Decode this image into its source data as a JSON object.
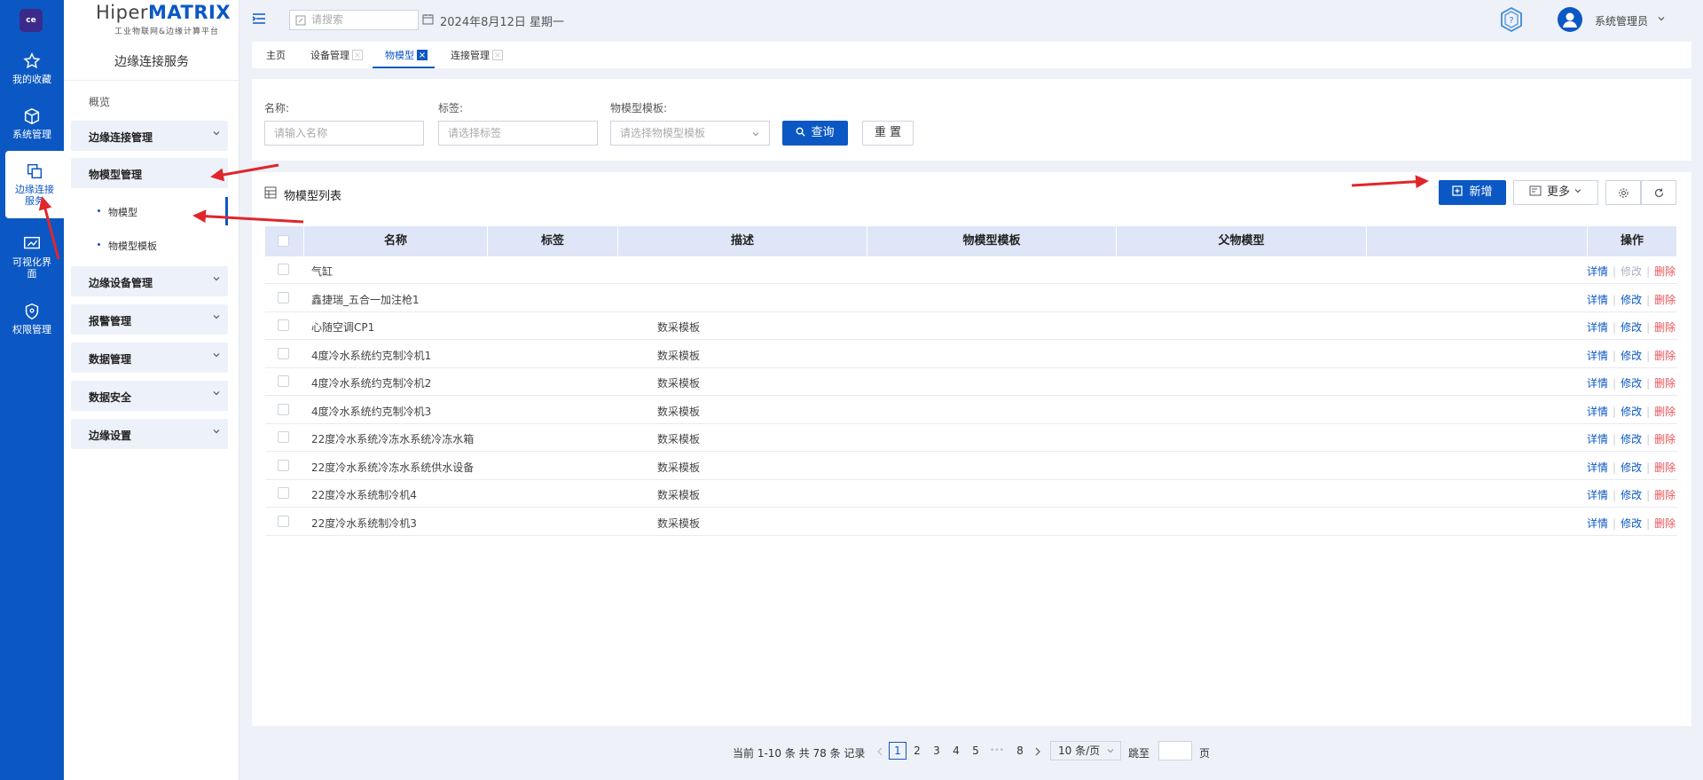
{
  "nav": {
    "logo_text": "ce",
    "items": [
      {
        "label": "我的收藏",
        "icon": "star-icon"
      },
      {
        "label": "系统管理",
        "icon": "cube-icon"
      },
      {
        "label": "边缘连接服务",
        "icon": "copy-icon"
      },
      {
        "label": "可视化界面",
        "icon": "monitor-icon"
      },
      {
        "label": "权限管理",
        "icon": "shield-icon"
      }
    ]
  },
  "brand": {
    "name_part1": "Hiper",
    "name_part2": "MATRIX",
    "subtitle": "工业物联网&边缘计算平台"
  },
  "sidebar": {
    "title": "边缘连接服务",
    "overview": "概览",
    "groups": [
      "边缘连接管理",
      "物模型管理",
      "边缘设备管理",
      "报警管理",
      "数据管理",
      "数据安全",
      "边缘设置"
    ],
    "subitems": [
      "物模型",
      "物模型模板"
    ]
  },
  "topbar": {
    "search_placeholder": "请搜索",
    "date": "2024年8月12日 星期一",
    "username": "系统管理员"
  },
  "tabs": [
    {
      "label": "主页"
    },
    {
      "label": "设备管理"
    },
    {
      "label": "物模型"
    },
    {
      "label": "连接管理"
    }
  ],
  "filter": {
    "name_label": "名称:",
    "name_placeholder": "请输入名称",
    "tag_label": "标签:",
    "tag_placeholder": "请选择标签",
    "template_label": "物模型模板:",
    "template_placeholder": "请选择物模型模板",
    "query_label": "查询",
    "reset_label": "重 置"
  },
  "list": {
    "title": "物模型列表",
    "add_label": "新增",
    "more_label": "更多",
    "columns": [
      "名称",
      "标签",
      "描述",
      "物模型模板",
      "父物模型",
      "操作"
    ],
    "op_detail": "详情",
    "op_edit": "修改",
    "op_delete": "删除",
    "rows": [
      {
        "name": "气缸",
        "desc": "",
        "edit_disabled": true
      },
      {
        "name": "鑫捷瑞_五合一加注枪1",
        "desc": "",
        "edit_disabled": false
      },
      {
        "name": "心随空调CP1",
        "desc": "数采模板",
        "edit_disabled": false
      },
      {
        "name": "4度冷水系统约克制冷机1",
        "desc": "数采模板",
        "edit_disabled": false
      },
      {
        "name": "4度冷水系统约克制冷机2",
        "desc": "数采模板",
        "edit_disabled": false
      },
      {
        "name": "4度冷水系统约克制冷机3",
        "desc": "数采模板",
        "edit_disabled": false
      },
      {
        "name": "22度冷水系统冷冻水系统冷冻水箱",
        "desc": "数采模板",
        "edit_disabled": false
      },
      {
        "name": "22度冷水系统冷冻水系统供水设备",
        "desc": "数采模板",
        "edit_disabled": false
      },
      {
        "name": "22度冷水系统制冷机4",
        "desc": "数采模板",
        "edit_disabled": false
      },
      {
        "name": "22度冷水系统制冷机3",
        "desc": "数采模板",
        "edit_disabled": false
      }
    ]
  },
  "pager": {
    "summary": "当前 1-10 条 共 78 条 记录",
    "pages": [
      "1",
      "2",
      "3",
      "4",
      "5"
    ],
    "ellipsis": "•••",
    "last_page": "8",
    "page_size": "10 条/页",
    "jump_label": "跳至",
    "page_unit": "页"
  },
  "colors": {
    "primary": "#0b58c4",
    "danger": "#e4545a",
    "arrow": "#e0262b"
  }
}
